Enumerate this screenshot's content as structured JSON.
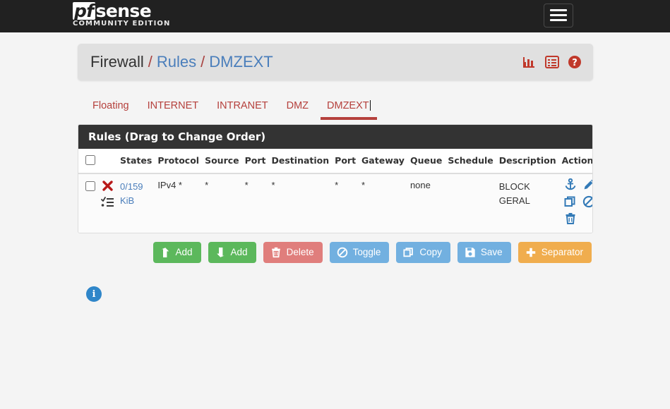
{
  "navbar": {
    "brand_pf": "pf",
    "brand_sense": "sense",
    "brand_subtitle": "COMMUNITY EDITION",
    "menu_toggle_label": "Toggle navigation"
  },
  "breadcrumb": {
    "root": "Firewall",
    "sep1": "/",
    "link": "Rules",
    "sep2": "/",
    "current": "DMZEXT",
    "icons": [
      {
        "name": "stats-icon",
        "title": "Traffic Graph"
      },
      {
        "name": "list-icon",
        "title": "Rule List"
      },
      {
        "name": "help-icon",
        "title": "Help"
      }
    ]
  },
  "tabs": [
    {
      "label": "Floating",
      "active": false
    },
    {
      "label": "INTERNET",
      "active": false
    },
    {
      "label": "INTRANET",
      "active": false
    },
    {
      "label": "DMZ",
      "active": false
    },
    {
      "label": "DMZEXT",
      "active": true
    }
  ],
  "panel": {
    "heading": "Rules (Drag to Change Order)",
    "columns": [
      "",
      "",
      "States",
      "Protocol",
      "Source",
      "Port",
      "Destination",
      "Port",
      "Gateway",
      "Queue",
      "Schedule",
      "Description",
      "Actions"
    ],
    "rows": [
      {
        "selected": false,
        "action_icon": "block-x-icon",
        "log_icon": "log-tasks-icon",
        "states": "0/159",
        "states_unit": "KiB",
        "protocol": "IPv4 *",
        "source": "*",
        "port": "*",
        "destination": "*",
        "dest_port": "*",
        "gateway": "*",
        "queue": "none",
        "schedule": "",
        "description_line1": "BLOCK",
        "description_line2": "GERAL",
        "actions": [
          {
            "name": "anchor-icon",
            "title": "Move"
          },
          {
            "name": "edit-pencil-icon",
            "title": "Edit"
          },
          {
            "name": "copy-icon",
            "title": "Copy"
          },
          {
            "name": "disable-ban-icon",
            "title": "Disable"
          },
          {
            "name": "delete-trash-icon",
            "title": "Delete"
          }
        ]
      }
    ]
  },
  "buttons": [
    {
      "label": "Add",
      "icon": "arrow-up-icon",
      "style": "green"
    },
    {
      "label": "Add",
      "icon": "arrow-down-icon",
      "style": "green"
    },
    {
      "label": "Delete",
      "icon": "trash-icon",
      "style": "red"
    },
    {
      "label": "Toggle",
      "icon": "ban-icon",
      "style": "blue"
    },
    {
      "label": "Copy",
      "icon": "copy-icon",
      "style": "blue"
    },
    {
      "label": "Save",
      "icon": "save-floppy-icon",
      "style": "save"
    },
    {
      "label": "Separator",
      "icon": "plus-icon",
      "style": "orange"
    }
  ],
  "footer": {
    "info_icon": "info-circle-icon",
    "info_glyph": "i"
  },
  "colors": {
    "navbar_bg": "#212121",
    "breadcrumb_bg": "#e0e0e0",
    "link_blue": "#4a7ebb",
    "tab_red": "#b5403c",
    "panel_heading_bg": "#333333",
    "page_bg": "#f4f4f4",
    "btn_green": "#5cb85c",
    "btn_red": "#e07e7c",
    "btn_blue": "#72b0e0",
    "btn_orange": "#f0ad4e",
    "icon_red": "#c0392b",
    "action_icon_blue": "#337ab7",
    "info_blue": "#2f86c9"
  }
}
